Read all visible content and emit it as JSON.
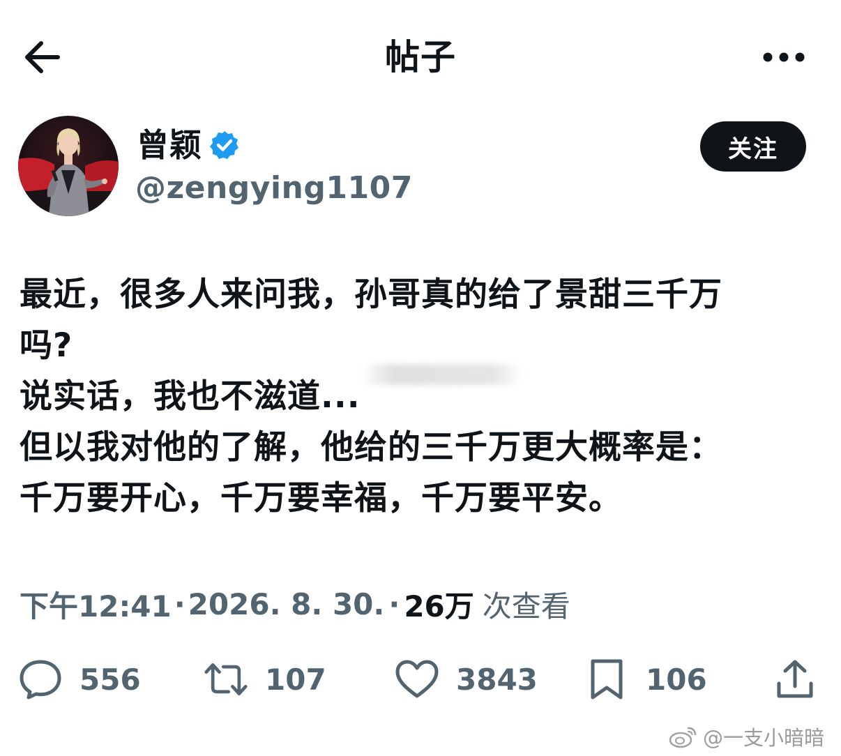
{
  "header": {
    "title": "帖子",
    "back_icon": "arrow-left-icon",
    "more_icon": "more-horizontal-icon"
  },
  "author": {
    "name": "曾颖",
    "handle": "@zengying1107",
    "verified": true,
    "follow_label": "关注",
    "avatar_icon": "avatar-photo"
  },
  "post": {
    "lines": [
      "最近，很多人来问我，孙哥真的给了景甜三千万",
      "吗?",
      "说实话，我也不滋道...",
      "但以我对他的了解，他给的三千万更大概率是：",
      "千万要开心，千万要幸福，千万要平安。"
    ]
  },
  "meta": {
    "time": "下午12:41",
    "sep1": "·",
    "date": "2026. 8. 30.",
    "sep2": "·",
    "views_count": "26万",
    "views_label": "次查看"
  },
  "actions": {
    "reply": {
      "icon": "reply-icon",
      "count": "556"
    },
    "repost": {
      "icon": "repost-icon",
      "count": "107"
    },
    "like": {
      "icon": "heart-icon",
      "count": "3843"
    },
    "bookmark": {
      "icon": "bookmark-icon",
      "count": "106"
    },
    "share": {
      "icon": "share-icon"
    }
  },
  "watermark": {
    "text": "@一支小暗暗"
  },
  "colors": {
    "text_primary": "#0f1419",
    "text_secondary": "#536471",
    "verified_blue": "#1d9bf0",
    "follow_bg": "#0f1419"
  }
}
